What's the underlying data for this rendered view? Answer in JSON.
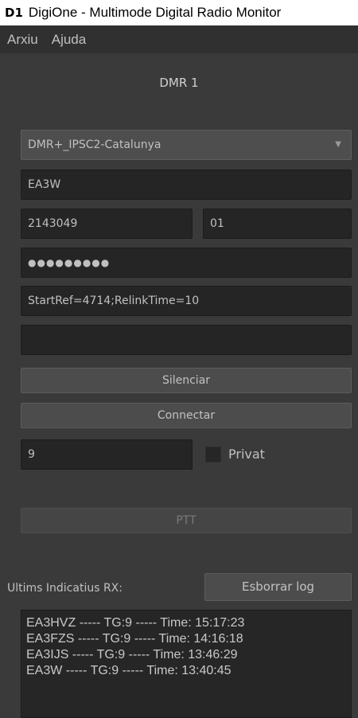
{
  "window": {
    "app_icon": "D1",
    "title": "DigiOne - Multimode Digital Radio Monitor"
  },
  "menu": {
    "items": [
      "Arxiu",
      "Ajuda"
    ]
  },
  "section_title": "DMR 1",
  "form": {
    "server": "DMR+_IPSC2-Catalunya",
    "callsign": "EA3W",
    "dmr_id": "2143049",
    "ess_id": "01",
    "password_mask": "●●●●●●●●●",
    "options": "StartRef=4714;RelinkTime=10",
    "extra": ""
  },
  "buttons": {
    "mute": "Silenciar",
    "connect": "Connectar",
    "ptt": "PTT",
    "clear_log": "Esborrar log"
  },
  "talkgroup": {
    "value": "9",
    "private_label": "Privat",
    "private_checked": false
  },
  "rx_log": {
    "label": "Ultims Indicatius RX:",
    "lines": [
      "EA3HVZ ----- TG:9 ----- Time: 15:17:23",
      "EA3FZS ----- TG:9 ----- Time: 14:16:18",
      "EA3IJS ----- TG:9 ----- Time: 13:46:29",
      "EA3W ----- TG:9 ----- Time: 13:40:45"
    ]
  }
}
